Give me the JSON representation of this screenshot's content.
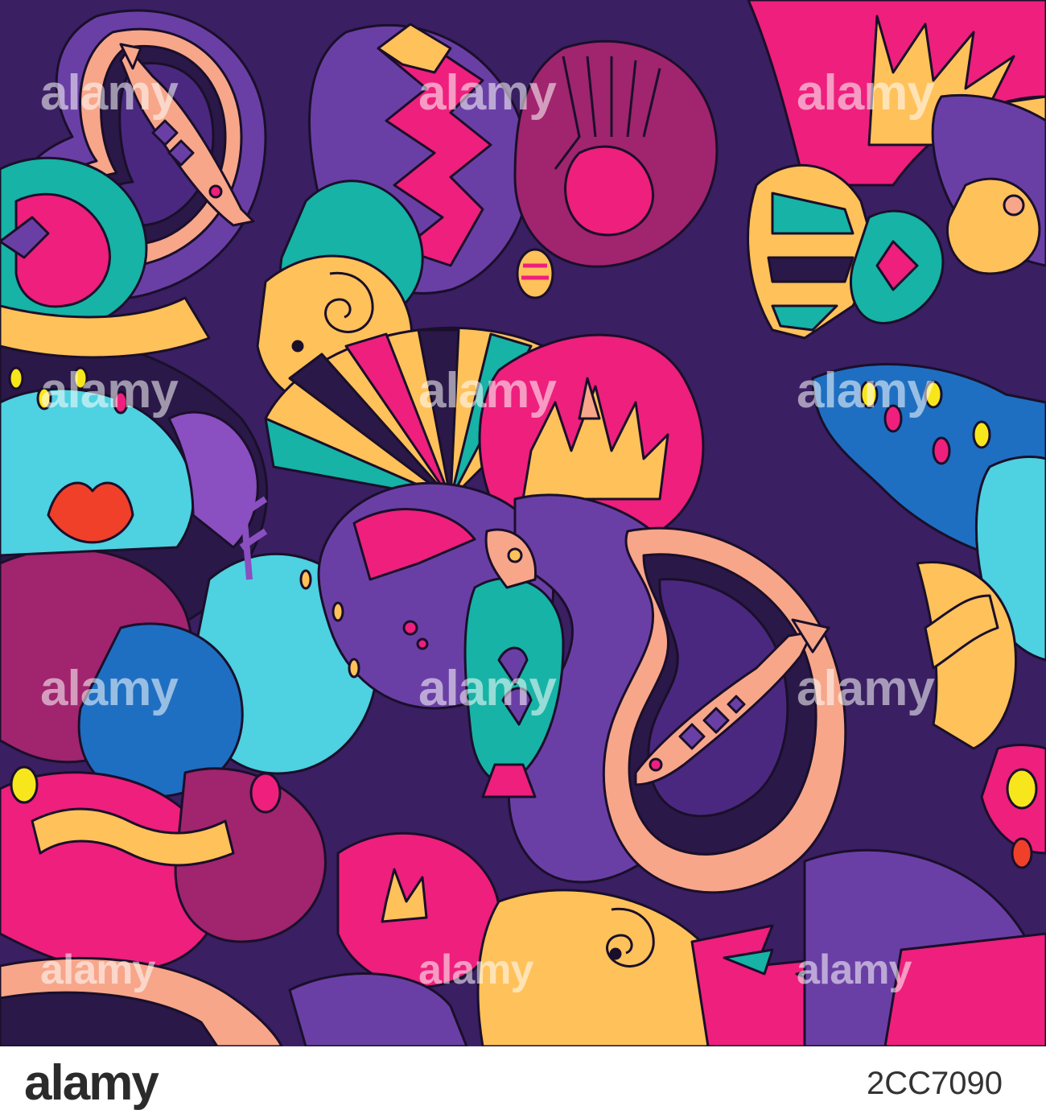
{
  "watermark": {
    "brand": "alamy"
  },
  "footer": {
    "brand": "alamy",
    "image_id": "2CC7090"
  },
  "colors": {
    "background": "#3a1f63",
    "deep_purple": "#2a1848",
    "purple": "#6a3fa5",
    "violet": "#8a4fc0",
    "magenta": "#ee1f7d",
    "pink_purple": "#a0246e",
    "teal": "#16b3a6",
    "cyan": "#4ed1e0",
    "blue": "#1e6fc2",
    "yellow": "#ffc15a",
    "bright_yellow": "#f7e61b",
    "peach": "#f7a68a",
    "red": "#f0402a",
    "outline": "#1a0f2a"
  }
}
